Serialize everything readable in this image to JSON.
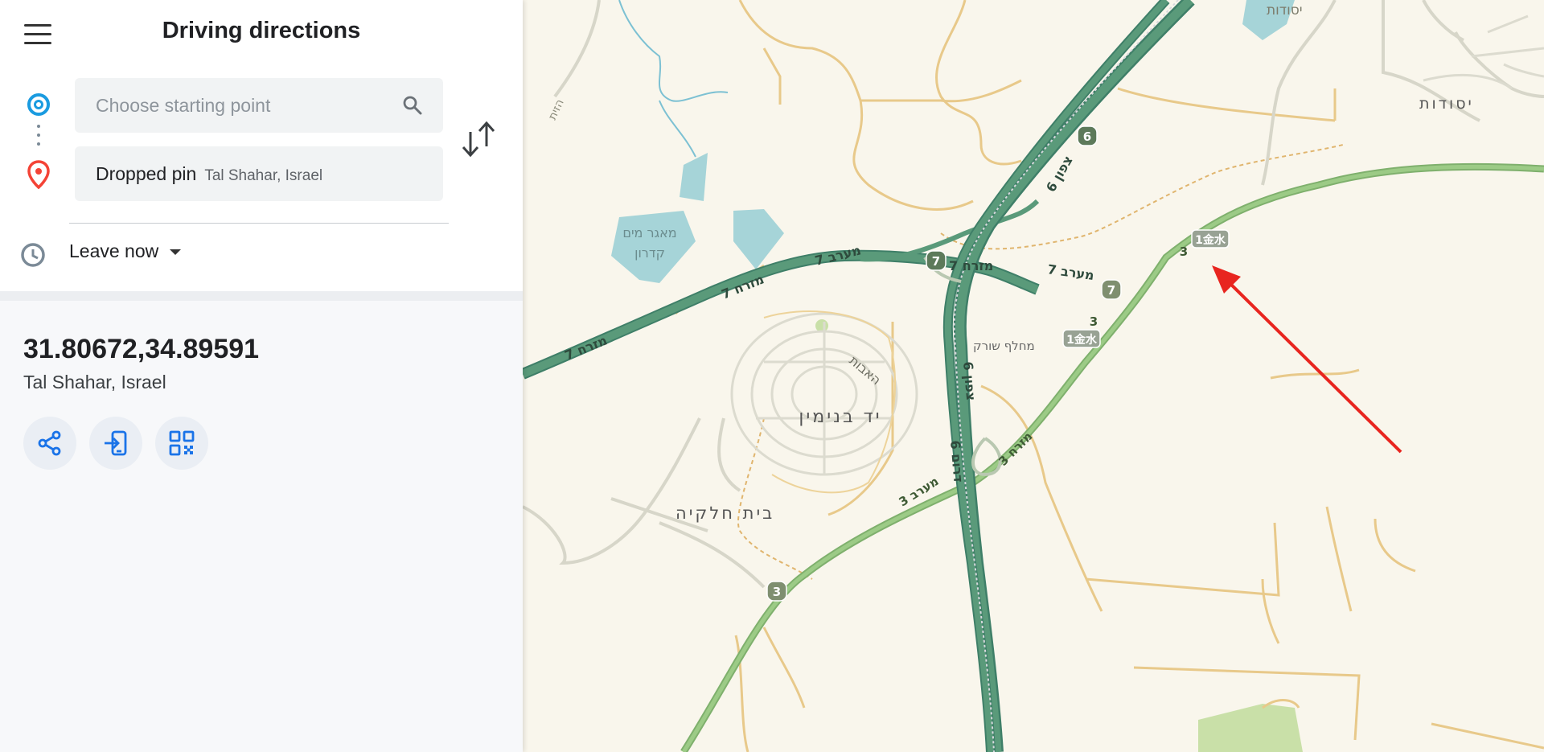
{
  "header": {
    "title": "Driving directions",
    "menu_icon": "hamburger-menu-icon"
  },
  "route": {
    "start": {
      "placeholder": "Choose starting point",
      "icon": "search-icon"
    },
    "destination": {
      "label": "Dropped pin",
      "sublabel": "Tal Shahar, Israel",
      "icon": "location-pin-icon"
    },
    "swap_icon": "swap-arrows-icon"
  },
  "time": {
    "label": "Leave now",
    "icon": "clock-icon"
  },
  "result": {
    "coordinates": "31.80672,34.89591",
    "place": "Tal Shahar, Israel",
    "actions": [
      {
        "name": "share",
        "icon": "share-icon"
      },
      {
        "name": "send-to-device",
        "icon": "send-to-phone-icon"
      },
      {
        "name": "qr-code",
        "icon": "qr-code-icon"
      }
    ]
  },
  "map": {
    "labels": {
      "yesodot_top": "יסודות",
      "yesodot": "יסודות",
      "reservoir": "מאגר מים",
      "kidron": "קדרון",
      "haavot": "האבות",
      "yad_binyamin": "יד בנימין",
      "beit_hilkiya": "בית חלקיה",
      "sorek": "מחלף שורק",
      "haziyt": "הזית",
      "r7_west_a": "7 מערב",
      "r7_east_a": "7 מזרח",
      "r7_east_b": "7 מזרח",
      "r7_east_c": "7 מזרח",
      "r7_west_b": "מערב 7",
      "r6_north_a": "6 צפון",
      "r6_north_b": "צפון 6",
      "r6_south": "6 דרום",
      "r3_west": "3 מערב",
      "r3_east": "3 מזרח",
      "shield_6": "6",
      "shield_7a": "7",
      "shield_7b": "7",
      "shield_3a": "3",
      "shield_3b": "3",
      "shield_3c": "3",
      "hwy_1a": "1金水",
      "hwy_1b": "1金水"
    },
    "colors": {
      "highway": "#5a9a7a",
      "route3": "#8cba78",
      "minor": "#e8c98a",
      "water": "#a6d4d8",
      "pin": "#f44336",
      "accent": "#1a9be0",
      "annotation_arrow": "#e8251f"
    }
  }
}
